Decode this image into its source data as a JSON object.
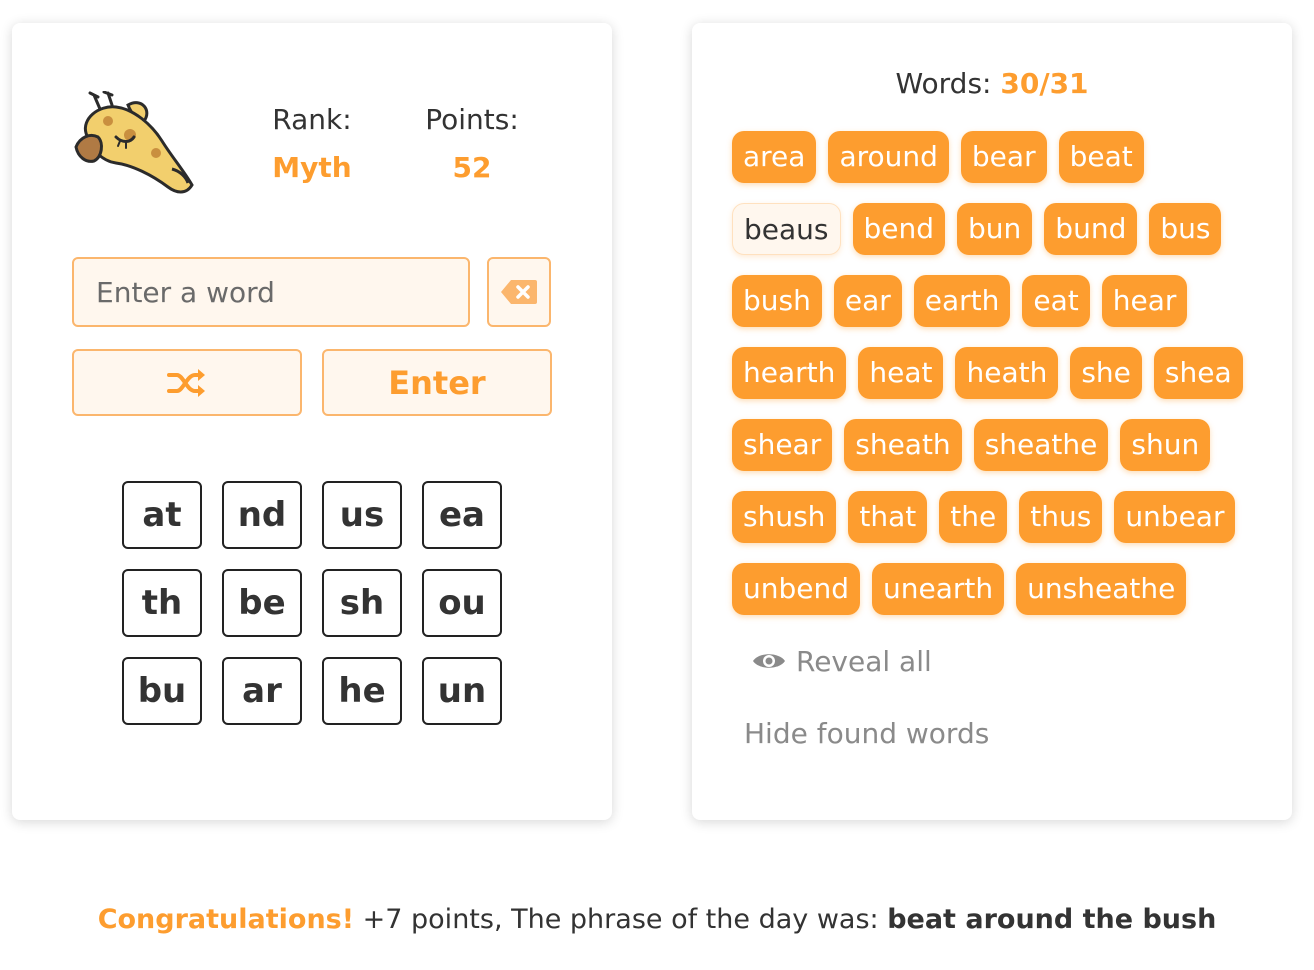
{
  "stats": {
    "rank_label": "Rank:",
    "rank_value": "Myth",
    "points_label": "Points:",
    "points_value": "52"
  },
  "input": {
    "placeholder": "Enter a word",
    "value": ""
  },
  "buttons": {
    "enter_label": "Enter",
    "shuffle_icon": "shuffle-icon",
    "backspace_icon": "backspace-icon"
  },
  "tiles": [
    "at",
    "nd",
    "us",
    "ea",
    "th",
    "be",
    "sh",
    "ou",
    "bu",
    "ar",
    "he",
    "un"
  ],
  "words_panel": {
    "label": "Words:",
    "count": "30/31",
    "words": [
      {
        "text": "area",
        "found": true
      },
      {
        "text": "around",
        "found": true
      },
      {
        "text": "bear",
        "found": true
      },
      {
        "text": "beat",
        "found": true
      },
      {
        "text": "beaus",
        "found": false
      },
      {
        "text": "bend",
        "found": true
      },
      {
        "text": "bun",
        "found": true
      },
      {
        "text": "bund",
        "found": true
      },
      {
        "text": "bus",
        "found": true
      },
      {
        "text": "bush",
        "found": true
      },
      {
        "text": "ear",
        "found": true
      },
      {
        "text": "earth",
        "found": true
      },
      {
        "text": "eat",
        "found": true
      },
      {
        "text": "hear",
        "found": true
      },
      {
        "text": "hearth",
        "found": true
      },
      {
        "text": "heat",
        "found": true
      },
      {
        "text": "heath",
        "found": true
      },
      {
        "text": "she",
        "found": true
      },
      {
        "text": "shea",
        "found": true
      },
      {
        "text": "shear",
        "found": true
      },
      {
        "text": "sheath",
        "found": true
      },
      {
        "text": "sheathe",
        "found": true
      },
      {
        "text": "shun",
        "found": true
      },
      {
        "text": "shush",
        "found": true
      },
      {
        "text": "that",
        "found": true
      },
      {
        "text": "the",
        "found": true
      },
      {
        "text": "thus",
        "found": true
      },
      {
        "text": "unbear",
        "found": true
      },
      {
        "text": "unbend",
        "found": true
      },
      {
        "text": "unearth",
        "found": true
      },
      {
        "text": "unsheathe",
        "found": true
      }
    ],
    "reveal_all_label": "Reveal all",
    "hide_found_label": "Hide found words"
  },
  "footer": {
    "congrats": "Congratulations!",
    "message": " +7 points, The phrase of the day was: ",
    "phrase": "beat around the bush"
  },
  "colors": {
    "accent": "#fd9d2f",
    "accent_light": "#fff7ee",
    "accent_border": "#fbb66d",
    "muted_text": "#8a8a8a"
  }
}
